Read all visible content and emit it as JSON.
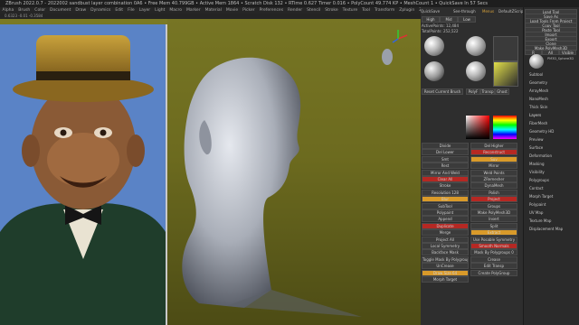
{
  "titlebar": {
    "text": "ZBrush 2022.0.7 - 2022002 sandbust layer combination 0A6  • Free Mem 40.799GB • Active Mem 1864 • Scratch Disk 132 • RTime 0.627 Timer 0.016 • PolyCount 49.774 KP • MeshCount 1 • QuickSave In 57 Secs"
  },
  "menubar": {
    "items": [
      "Alpha",
      "Brush",
      "Color",
      "Document",
      "Draw",
      "Dynamics",
      "Edit",
      "File",
      "Layer",
      "Light",
      "Macro",
      "Marker",
      "Material",
      "Movie",
      "Picker",
      "Preferences",
      "Render",
      "Stencil",
      "Stroke",
      "Texture",
      "Tool",
      "Transform",
      "Zplugin",
      "Zscript",
      "ZModeler"
    ]
  },
  "infobar": {
    "text": "0.6323  -0.01  -0.3584"
  },
  "topright": {
    "quicksave": "QuickSave",
    "seethrough": "See-through",
    "menus": "Menus",
    "defaultzscript": "DefaultZScript"
  },
  "left_palette": {
    "tabs": [
      "High",
      "Mid",
      "Low"
    ],
    "active_points": "ActivePoints: 12,484",
    "total_points": "TotalPoints: 252,522",
    "brushes": [
      "Move",
      "Standard",
      "Smooth",
      "ClayBuildup"
    ],
    "reset_brush": "Reset Current Brush",
    "polyf": "PolyF",
    "transp": "Transp",
    "ghost": "Ghost",
    "solo": "Solo",
    "xpose": "Xpose",
    "stroke": "DragRect",
    "alpha_off": "Alpha Off",
    "texture_off": "Texture Off",
    "rgb": "Rgb",
    "m": "M",
    "mrgb": "Mrgb",
    "zadd": "Zadd",
    "zsub": "Zsub",
    "sliders": [
      "Z Intensity 100",
      "Draw Size 64",
      "Focal Shift 0",
      "RGB Intensity 100",
      "Dynamic"
    ],
    "buttons": [
      "Divide",
      "Del Higher",
      "Del Lower",
      "Reconstruct",
      "Smt",
      "Suv",
      "Rest",
      "Mirror",
      "Mirror And Weld",
      "Weld Points",
      "Clear All",
      "ZRemesher",
      "Stroke",
      "DynaMesh",
      "Resolution 128",
      "Polish",
      "Blur",
      "Project",
      "SubTool",
      "Groups",
      "Polypaint",
      "Make PolyMesh3D",
      "Append",
      "Insert",
      "Duplicate",
      "Split",
      "Merge",
      "Extract",
      "Project All"
    ],
    "labels": [
      "Floor",
      "Local",
      "Frame",
      "Move",
      "Scale",
      "Rotate",
      "PolyF",
      "Persp",
      "Actual",
      "AAHalf",
      "Sym"
    ],
    "symmetry": "Activate Symmetry",
    "axes": [
      "X",
      "Y",
      "Z"
    ],
    "radial": "RadialCount 1",
    "modifiers": [
      "Use Posable Symmetry",
      "Local Symmetry",
      "Smooth Normals",
      "Backface Mask",
      "Mask By Polygroups 0",
      "Toggle Mask By Polygroups",
      "Crease",
      "UnCrease",
      "Edit Transp",
      "Draw Size 64",
      "Create PolyGroup",
      "Morph Target"
    ],
    "bottom": [
      "Mask Changed Points",
      "Extrude Depth",
      "Replace List"
    ]
  },
  "right_panel": {
    "top_buttons": [
      "Load Tool",
      "Save As",
      "Load Tools From Project",
      "Copy Tool",
      "Paste Tool",
      "Import",
      "Export",
      "Clone",
      "Make PolyMesh3D",
      "GoZ",
      "All",
      "Visible",
      "R"
    ],
    "lightbox": "Lightbox",
    "tools": "Tools",
    "sphere_label": "PM3D_Sphere3D",
    "sections": [
      "Subtool",
      "Geometry",
      "ArrayMesh",
      "NanoMesh",
      "Thick Skin",
      "Layers",
      "FiberMesh",
      "Geometry HD",
      "Preview",
      "Surface",
      "Deformation",
      "Masking",
      "Visibility",
      "Polygroups",
      "Contact",
      "Morph Target",
      "Polypaint",
      "UV Map",
      "Texture Map",
      "Displacement Map"
    ],
    "layers_label": "Layers",
    "bake_all": "Bake All",
    "record": "Record Deformation Animation"
  },
  "viewport": {
    "floor_color": "#75741f"
  }
}
